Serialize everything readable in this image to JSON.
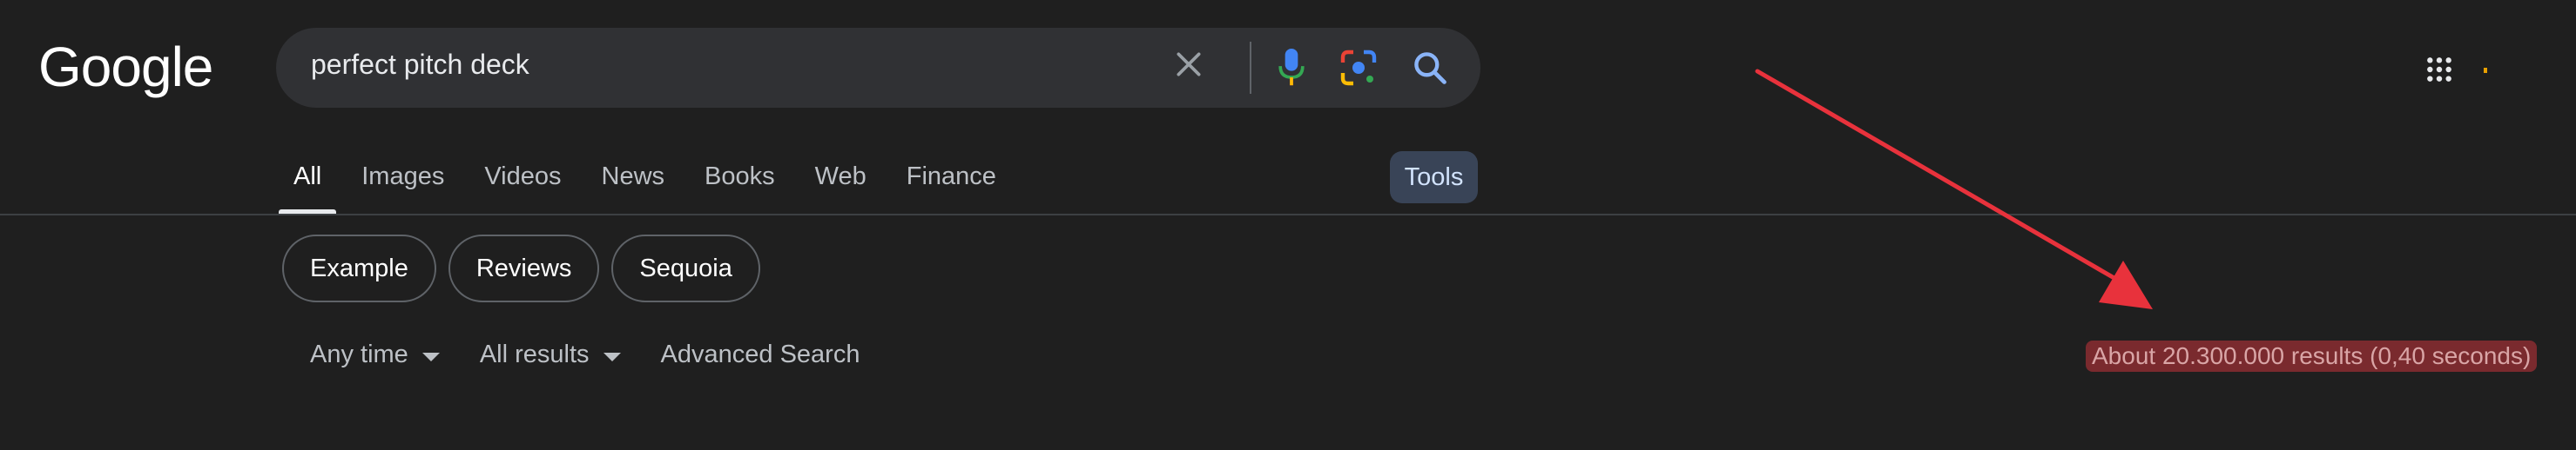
{
  "header": {
    "logo_text": "Google",
    "search": {
      "value": "perfect pitch deck"
    },
    "icons": [
      "clear-icon",
      "mic-icon",
      "lens-icon",
      "search-icon",
      "apps-icon"
    ],
    "accent_colors": {
      "mic_blue": "#4285f4",
      "mic_red": "#ea4335",
      "lens_colors": [
        "#ea4335",
        "#fbbc05",
        "#34a853",
        "#4285f4"
      ],
      "search_blue": "#8ab4f8"
    }
  },
  "tabs": [
    {
      "label": "All",
      "active": true
    },
    {
      "label": "Images",
      "active": false
    },
    {
      "label": "Videos",
      "active": false
    },
    {
      "label": "News",
      "active": false
    },
    {
      "label": "Books",
      "active": false
    },
    {
      "label": "Web",
      "active": false
    },
    {
      "label": "Finance",
      "active": false
    }
  ],
  "tools_label": "Tools",
  "chips": [
    {
      "label": "Example"
    },
    {
      "label": "Reviews"
    },
    {
      "label": "Sequoia"
    }
  ],
  "filters": {
    "time": "Any time",
    "results": "All results",
    "advanced": "Advanced Search"
  },
  "result_stats": "About 20.300.000 results (0,40 seconds)",
  "annotation": {
    "arrow_color": "#e8323c",
    "highlight_color": "#7a2a2e"
  }
}
